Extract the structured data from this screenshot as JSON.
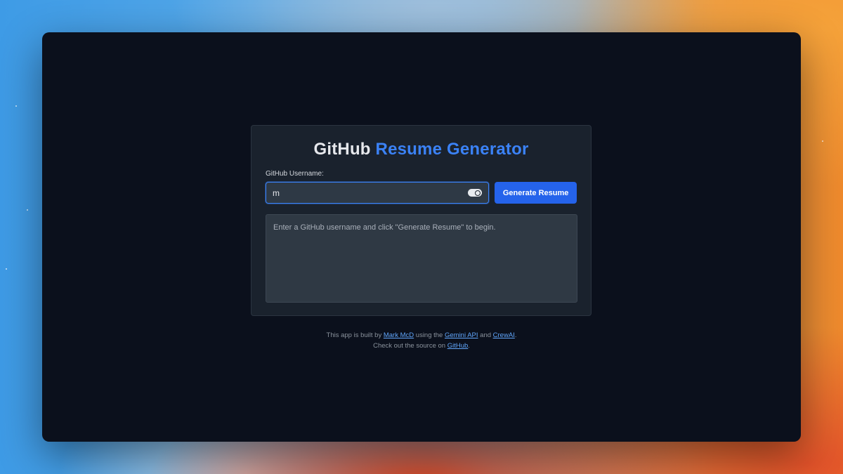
{
  "app": {
    "title_part1": "GitHub",
    "title_part2": "Resume Generator"
  },
  "form": {
    "username_label": "GitHub Username:",
    "username_value": "m",
    "generate_button": "Generate Resume"
  },
  "output": {
    "placeholder_text": "Enter a GitHub username and click \"Generate Resume\" to begin."
  },
  "footer": {
    "line1_prefix": "This app is built by ",
    "author_link": "Mark McD",
    "line1_middle": " using the ",
    "gemini_link": "Gemini API",
    "line1_and": " and ",
    "crewai_link": "CrewAI",
    "line1_suffix": ".",
    "line2_prefix": "Check out the source on ",
    "github_link": "GitHub",
    "line2_suffix": "."
  },
  "colors": {
    "accent": "#3b82f6",
    "button": "#2563eb",
    "window_bg": "#0b101c",
    "card_bg": "#1a222d"
  }
}
